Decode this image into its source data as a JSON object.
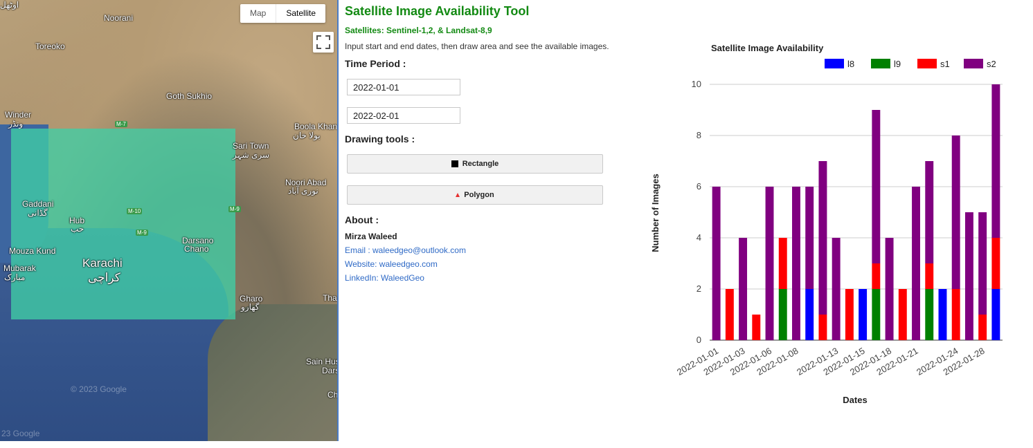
{
  "map": {
    "map_type_options": [
      "Map",
      "Satellite"
    ],
    "selected_map_type": "Satellite",
    "labels": {
      "noorani": "Noorani",
      "toreoko": "Toreoko",
      "goth_sukhio": "Goth Sukhio",
      "winder": "Winder",
      "winder_ur": "ونڈر",
      "bola_khan": "Boola Khan",
      "bola_khan_ur": "بولا خان",
      "sari_town": "Sari Town",
      "sari_town_ur": "سری شہر",
      "noori_abad": "Noori Abad",
      "noori_abad_ur": "نوری آباد",
      "gaddani": "Gaddani",
      "gaddani_ur": "گڈانی",
      "hub": "Hub",
      "hub_ur": "حب",
      "mouza_kund": "Mouza Kund",
      "mubarak": "Mubarak",
      "mubarak_ur": "مبارک",
      "karachi": "Karachi",
      "karachi_ur": "کراچی",
      "darsano_chano": "Darsano",
      "darsano_chano2": "Chano",
      "gharo": "Gharo",
      "gharo_ur": "گھارو",
      "thatta": "Tha",
      "sain_hus": "Sain Hus",
      "dars": "Dars",
      "ch": "Ch",
      "top_left": "اوٹھل",
      "highway_m7": "M-7",
      "highway_m10": "M-10",
      "highway_m9": "M-9",
      "highway_m9b": "M-9"
    },
    "watermark": "© 2023 Google",
    "watermark2": "23 Google"
  },
  "panel": {
    "title": "Satellite Image Availability Tool",
    "subtitle": "Satellites: Sentinel-1,2, & Landsat-8,9",
    "description": "Input start and end dates, then draw area and see the available images.",
    "time_period_label": "Time Period :",
    "start_date": "2022-01-01",
    "end_date": "2022-02-01",
    "drawing_tools_label": "Drawing tools :",
    "rectangle_label": "Rectangle",
    "polygon_label": "Polygon",
    "about_label": "About :",
    "author": "Mirza Waleed",
    "email": "Email : waleedgeo@outlook.com",
    "website": "Website: waleedgeo.com",
    "linkedin": "LinkedIn: WaleedGeo"
  },
  "chart_data": {
    "type": "bar",
    "stacked": true,
    "title": "Satellite Image Availability",
    "xlabel": "Dates",
    "ylabel": "Number of Images",
    "ylim": [
      0,
      10
    ],
    "yticks": [
      0,
      2,
      4,
      6,
      8,
      10
    ],
    "legend_position": "top-right",
    "categories": [
      "2022-01-01",
      "2022-01-02",
      "2022-01-03",
      "2022-01-05",
      "2022-01-06",
      "2022-01-07",
      "2022-01-08",
      "2022-01-09",
      "2022-01-10",
      "2022-01-13",
      "2022-01-14",
      "2022-01-15",
      "2022-01-16",
      "2022-01-18",
      "2022-01-19",
      "2022-01-21",
      "2022-01-22",
      "2022-01-23",
      "2022-01-24",
      "2022-01-26",
      "2022-01-28",
      "2022-01-29"
    ],
    "tick_labels": [
      "2022-01-01",
      "2022-01-03",
      "2022-01-06",
      "2022-01-08",
      "2022-01-13",
      "2022-01-15",
      "2022-01-18",
      "2022-01-21",
      "2022-01-24",
      "2022-01-28"
    ],
    "series": [
      {
        "name": "l8",
        "color": "#0000ff",
        "values": [
          0,
          0,
          0,
          0,
          0,
          0,
          0,
          2,
          0,
          0,
          0,
          2,
          0,
          0,
          0,
          0,
          0,
          2,
          0,
          0,
          0,
          2
        ]
      },
      {
        "name": "l9",
        "color": "#008000",
        "values": [
          0,
          0,
          0,
          0,
          0,
          2,
          0,
          0,
          0,
          0,
          0,
          0,
          2,
          0,
          0,
          0,
          2,
          0,
          0,
          0,
          0,
          0
        ]
      },
      {
        "name": "s1",
        "color": "#ff0000",
        "values": [
          0,
          2,
          0,
          1,
          0,
          2,
          0,
          0,
          1,
          0,
          2,
          0,
          1,
          0,
          2,
          0,
          1,
          0,
          2,
          0,
          1,
          2
        ]
      },
      {
        "name": "s2",
        "color": "#800080",
        "values": [
          6,
          0,
          4,
          0,
          6,
          0,
          6,
          4,
          6,
          4,
          0,
          0,
          6,
          4,
          0,
          6,
          4,
          0,
          6,
          5,
          4,
          6
        ]
      }
    ]
  }
}
